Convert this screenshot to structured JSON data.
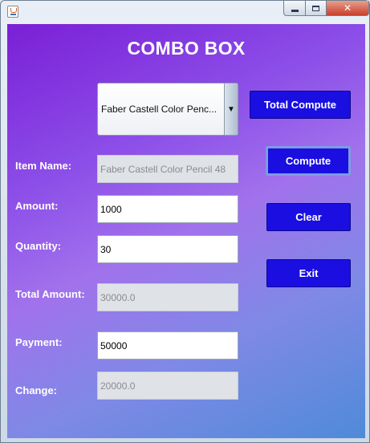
{
  "window": {
    "title": "",
    "controls": {
      "minimize": "",
      "maximize": "",
      "close": "✕"
    }
  },
  "form": {
    "heading": "COMBO BOX",
    "combo_selected": "Faber Castell Color Penc...",
    "labels": {
      "item_name": "Item Name:",
      "amount": "Amount:",
      "quantity": "Quantity:",
      "total_amount": "Total Amount:",
      "payment": "Payment:",
      "change": "Change:"
    },
    "values": {
      "item_name": "Faber Castell Color Pencil 48",
      "amount": "1000",
      "quantity": "30",
      "total_amount": "30000.0",
      "payment": "50000",
      "change": "20000.0"
    }
  },
  "buttons": {
    "total_compute": "Total Compute",
    "compute": "Compute",
    "clear": "Clear",
    "exit": "Exit"
  },
  "colors": {
    "button_bg": "#1a0fe0",
    "gradient_top": "#7a1fd6",
    "gradient_bottom": "#4f8ad8"
  }
}
